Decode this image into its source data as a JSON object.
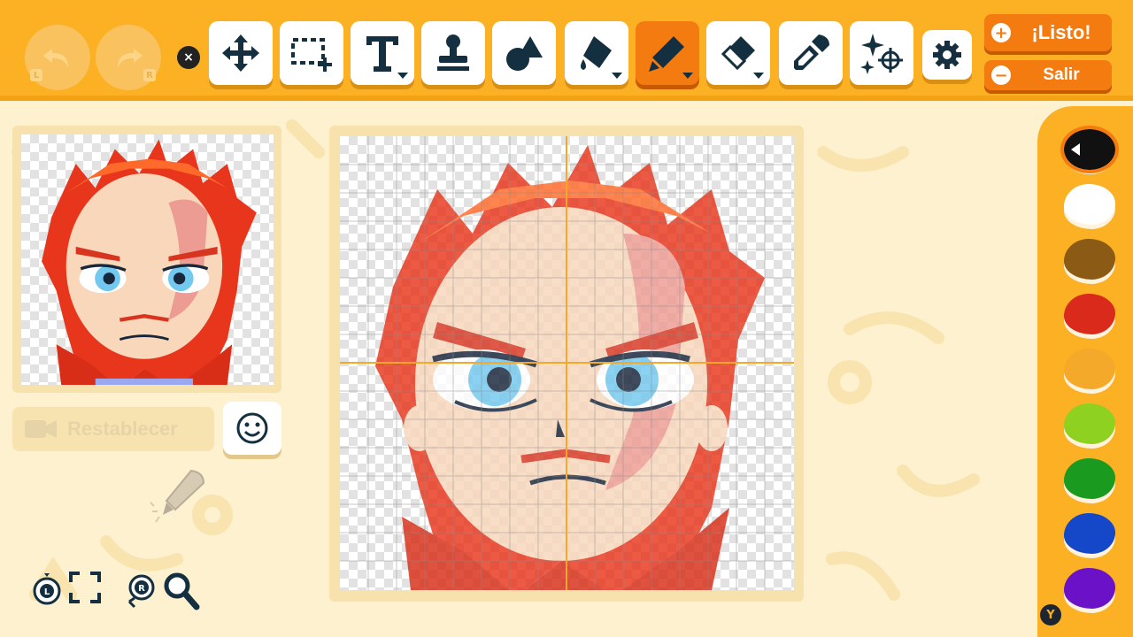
{
  "toolbar": {
    "undo_icon": "undo-icon",
    "redo_icon": "redo-icon",
    "undo_key": "L",
    "redo_key": "R",
    "close_glyph": "×",
    "tools": [
      {
        "name": "move",
        "icon": "move-arrows-icon"
      },
      {
        "name": "select",
        "icon": "selection-icon"
      },
      {
        "name": "text",
        "icon": "text-icon"
      },
      {
        "name": "stamp",
        "icon": "stamp-icon"
      },
      {
        "name": "shapes",
        "icon": "shapes-icon"
      },
      {
        "name": "fill",
        "icon": "paint-bucket-icon"
      },
      {
        "name": "pen",
        "icon": "pen-icon",
        "active": true
      },
      {
        "name": "eraser",
        "icon": "eraser-icon"
      },
      {
        "name": "eyedropper",
        "icon": "eyedropper-icon"
      },
      {
        "name": "effects",
        "icon": "sparkle-target-icon"
      }
    ],
    "settings_icon": "gear-icon",
    "done_label": "¡Listo!",
    "exit_label": "Salir",
    "done_glyph": "+",
    "exit_glyph": "−"
  },
  "preview": {
    "reset_label": "Restablecer",
    "camera_icon": "camera-icon",
    "smiley_icon": "smiley-icon",
    "brush_hint_icon": "brush-icon"
  },
  "bottom_controls": {
    "l_key": "L",
    "r_key": "R",
    "fullscreen_icon": "fullscreen-icon",
    "zoom_icon": "magnifier-icon"
  },
  "palette": {
    "y_key": "Y",
    "colors": [
      "#111111",
      "#ffffff",
      "#8b5a14",
      "#d92a1c",
      "#f5a92a",
      "#8fd120",
      "#1a9a1e",
      "#1448c8",
      "#6b12c8"
    ],
    "selected_index": 0
  },
  "accent_colors": {
    "toolbar": "#fbb123",
    "active": "#f47b10",
    "background": "#fdf1cf"
  }
}
